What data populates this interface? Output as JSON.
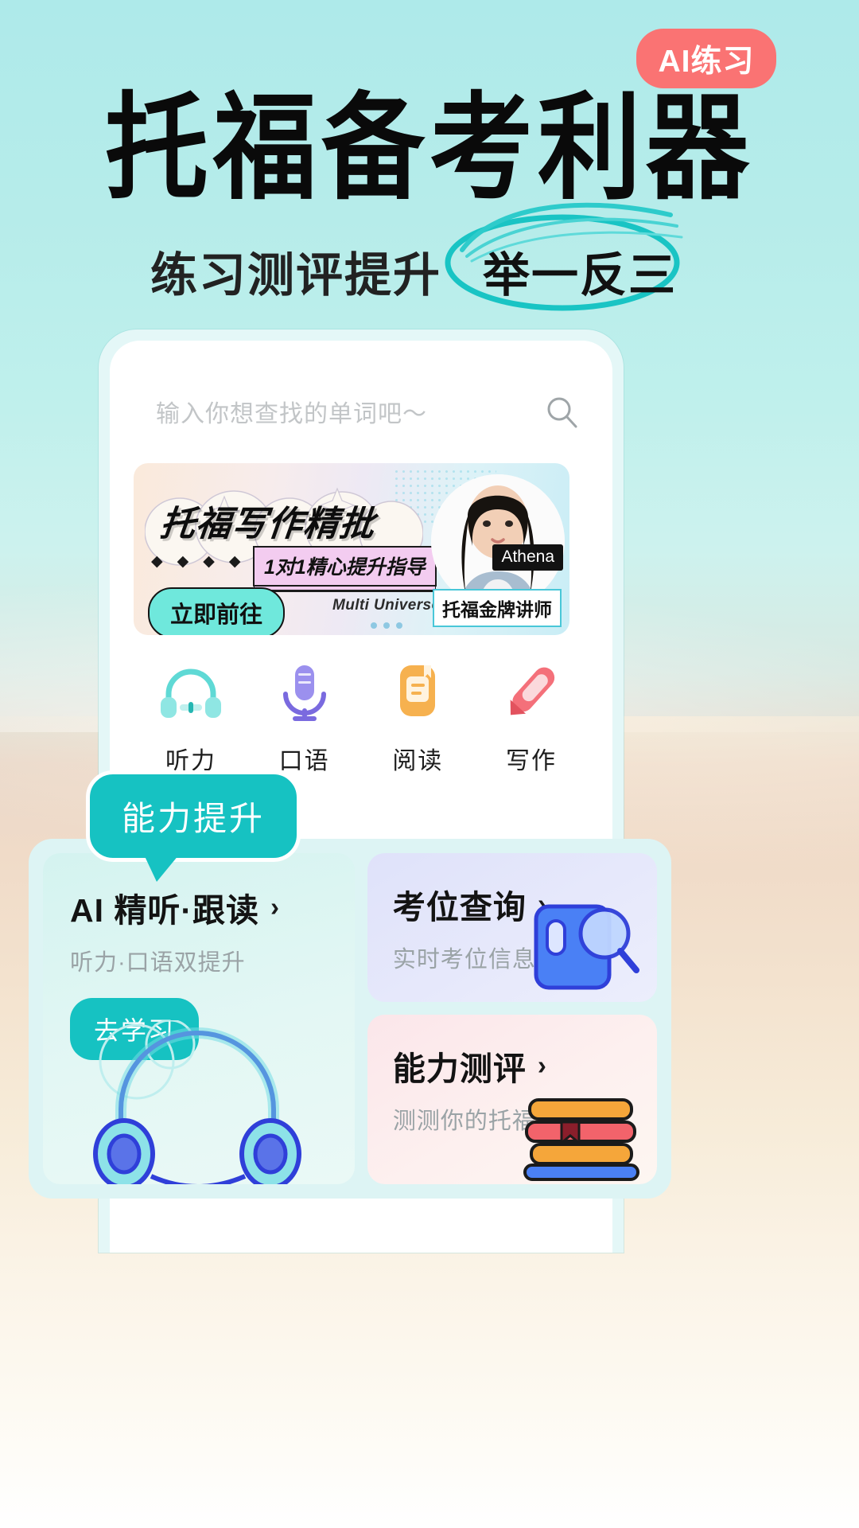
{
  "poster": {
    "badge": "AI练习",
    "headline": "托福备考利器",
    "subtitle_left": "练习测评提升",
    "subtitle_circled": "举一反三",
    "accent_teal": "#16C2C2",
    "badge_color": "#FA7373"
  },
  "app": {
    "search": {
      "placeholder": "输入你想查找的单词吧～",
      "icon": "search-icon"
    },
    "banner": {
      "title": "托福写作精批",
      "tagline": "1对1精心提升指导",
      "cta": "立即前往",
      "brand": "Multi Universe Education",
      "teacher_name": "Athena",
      "teacher_role": "托福金牌讲师",
      "diamonds": [
        "◆",
        "◆",
        "◆",
        "◆"
      ]
    },
    "categories": [
      {
        "label": "听力",
        "icon": "headphones-icon",
        "color": "#6FE0DE"
      },
      {
        "label": "口语",
        "icon": "microphone-icon",
        "color": "#8B82E8"
      },
      {
        "label": "阅读",
        "icon": "document-icon",
        "color": "#F5A63A"
      },
      {
        "label": "写作",
        "icon": "pen-icon",
        "color": "#F2636B"
      }
    ],
    "bubble_tag": "能力提升",
    "cards": [
      {
        "name": "ai-listening-card",
        "title": "AI 精听·跟读",
        "chevron": "›",
        "subtitle": "听力·口语双提升",
        "button": "去学习",
        "art": "headphones-illustration"
      },
      {
        "name": "exam-seat-card",
        "title": "考位查询",
        "chevron": "›",
        "subtitle": "实时考位信息",
        "art": "search-book-illustration"
      },
      {
        "name": "ability-assessment-card",
        "title": "能力测评",
        "chevron": "›",
        "subtitle": "测测你的托福能力",
        "art": "books-illustration"
      }
    ]
  }
}
